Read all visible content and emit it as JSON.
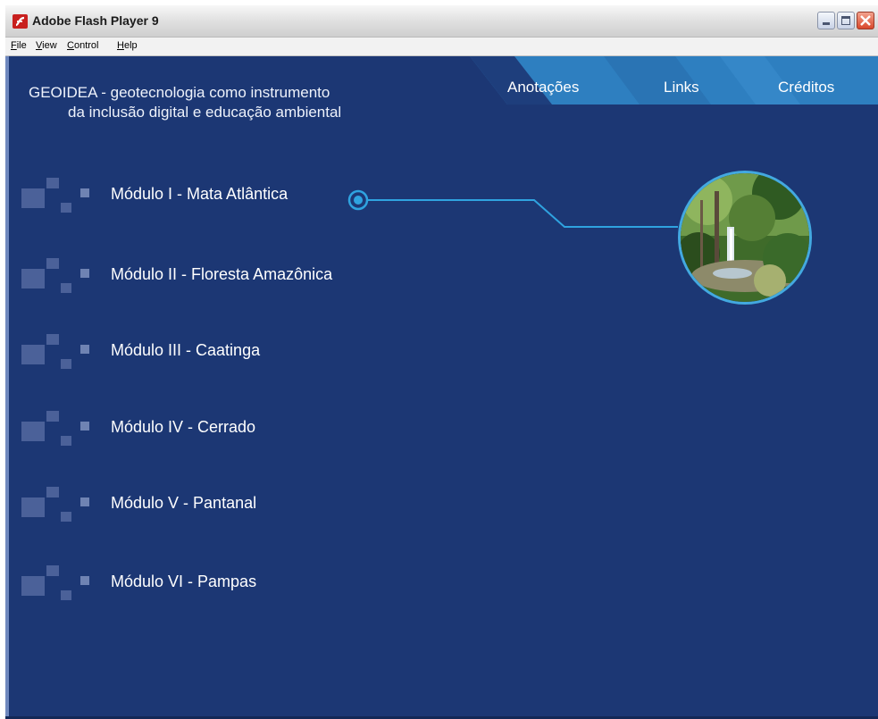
{
  "window": {
    "title": "Adobe Flash Player 9"
  },
  "menu": [
    "File",
    "View",
    "Control",
    "Help"
  ],
  "header": {
    "title_line1": "GEOIDEA - geotecnologia como instrumento",
    "title_line2": "da inclusão digital e educação ambiental"
  },
  "nav": {
    "items": [
      "Anotações",
      "Links",
      "Créditos"
    ]
  },
  "modules": [
    "Módulo I - Mata Atlântica",
    "Módulo II - Floresta Amazônica",
    "Módulo III - Caatinga",
    "Módulo IV - Cerrado",
    "Módulo V - Pantanal",
    "Módulo VI - Pampas"
  ],
  "selected_module_index": 0,
  "colors": {
    "background": "#1c3774",
    "accent": "#2fa3e0",
    "nav": "#2e7fc0"
  }
}
